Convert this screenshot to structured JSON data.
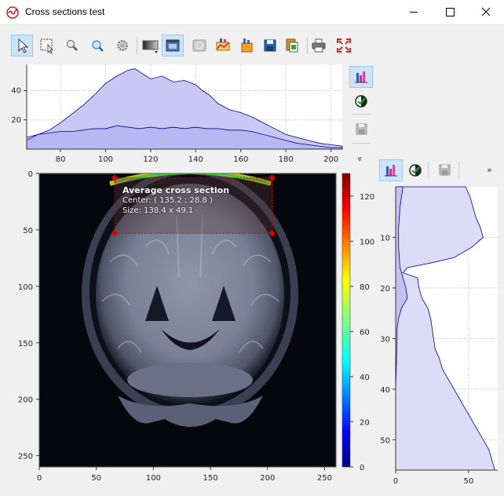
{
  "window": {
    "title": "Cross sections test"
  },
  "toolbar": {
    "items": [
      "select-arrow-icon",
      "zoom-rect-icon",
      "zoom-out-icon",
      "zoom-in-icon",
      "settings-gear-icon",
      "colormap-icon",
      "image-view-icon",
      "stats-icon",
      "grid-icon",
      "plot-icon",
      "save-icon",
      "copy-icon",
      "print-icon",
      "fullscreen-icon"
    ]
  },
  "overlay": {
    "title": "Average cross section",
    "center": "Center: ( 135.2 ; 28.8 )",
    "size": "Size: 138.4 x 49.1"
  },
  "side_toolbar": {
    "chevron": "»",
    "chevron_down": "»"
  },
  "colors": {
    "accent": "#cce4f7",
    "curve": "#00008b",
    "fill_dark": "#b8b8f0",
    "fill_light": "#dcdcf8",
    "roi": "#cc0000"
  },
  "chart_data": [
    {
      "type": "area",
      "name": "top-cross-section",
      "xlim": [
        65,
        205
      ],
      "ylim": [
        0,
        58
      ],
      "xticks": [
        "80",
        "100",
        "120",
        "140",
        "160",
        "180",
        "200"
      ],
      "xtick_values": [
        80,
        100,
        120,
        140,
        160,
        180,
        200
      ],
      "yticks": [
        "20",
        "40"
      ],
      "ytick_values": [
        20,
        40
      ],
      "series": [
        {
          "kind": "average",
          "x": [
            65,
            70,
            75,
            80,
            85,
            90,
            95,
            100,
            105,
            110,
            113,
            116,
            120,
            125,
            130,
            135,
            140,
            143,
            146,
            150,
            155,
            160,
            165,
            170,
            175,
            180,
            185,
            190,
            195,
            200,
            205
          ],
          "y": [
            8,
            10,
            13,
            18,
            24,
            30,
            37,
            45,
            50,
            54,
            55,
            52,
            48,
            50,
            46,
            47,
            44,
            40,
            37,
            31,
            27,
            25,
            22,
            18,
            14,
            10,
            8,
            6,
            4,
            3,
            2
          ]
        },
        {
          "kind": "profile",
          "x": [
            65,
            70,
            75,
            80,
            85,
            90,
            95,
            100,
            105,
            110,
            115,
            120,
            125,
            130,
            135,
            140,
            145,
            150,
            155,
            160,
            165,
            170,
            175,
            180,
            185,
            190,
            195,
            200,
            205
          ],
          "y": [
            6,
            10,
            11,
            12,
            12,
            13,
            14,
            14,
            16,
            15,
            14,
            15,
            14,
            15,
            14,
            15,
            14,
            14,
            13,
            13,
            12,
            10,
            8,
            6,
            4,
            3,
            2,
            1,
            1
          ]
        }
      ]
    },
    {
      "type": "heatmap",
      "name": "mri-image",
      "xlim": [
        0,
        260
      ],
      "ylim": [
        0,
        260
      ],
      "xticks": [
        "0",
        "50",
        "100",
        "150",
        "200",
        "250"
      ],
      "xtick_values": [
        0,
        50,
        100,
        150,
        200,
        250
      ],
      "yticks": [
        "0",
        "50",
        "100",
        "150",
        "200",
        "250"
      ],
      "ytick_values": [
        0,
        50,
        100,
        150,
        200,
        250
      ],
      "colorbar": {
        "range": [
          0,
          130
        ],
        "ticks": [
          "0",
          "20",
          "40",
          "60",
          "80",
          "100",
          "120"
        ],
        "tick_values": [
          0,
          20,
          40,
          60,
          80,
          100,
          120
        ]
      },
      "roi": {
        "x0": 66,
        "x1": 204,
        "y0": 4,
        "y1": 53
      }
    },
    {
      "type": "area",
      "name": "right-cross-section",
      "ylim": [
        0,
        56
      ],
      "xlim": [
        0,
        70
      ],
      "xticks": [
        "0",
        "50"
      ],
      "xtick_values": [
        0,
        50
      ],
      "yticks": [
        "10",
        "20",
        "30",
        "40",
        "50"
      ],
      "ytick_values": [
        10,
        20,
        30,
        40,
        50
      ],
      "series": [
        {
          "kind": "average",
          "y": [
            0,
            2,
            4,
            6,
            8,
            10,
            12,
            14,
            15,
            16,
            17,
            18,
            20,
            22,
            24,
            26,
            28,
            30,
            32,
            34,
            36,
            38,
            40,
            42,
            44,
            46,
            48,
            50,
            52,
            54,
            56
          ],
          "x": [
            48,
            51,
            53,
            55,
            58,
            60,
            52,
            40,
            25,
            8,
            5,
            15,
            16,
            18,
            22,
            24,
            25,
            26,
            27,
            30,
            32,
            36,
            40,
            44,
            48,
            52,
            56,
            60,
            64,
            66,
            68
          ]
        },
        {
          "kind": "profile",
          "y": [
            0,
            4,
            8,
            12,
            16,
            18,
            20,
            22,
            24,
            26,
            28,
            30,
            40,
            50,
            56
          ],
          "x": [
            5,
            3,
            2,
            2,
            3,
            5,
            7,
            8,
            4,
            2,
            1,
            1,
            0,
            0,
            0
          ]
        }
      ]
    }
  ]
}
